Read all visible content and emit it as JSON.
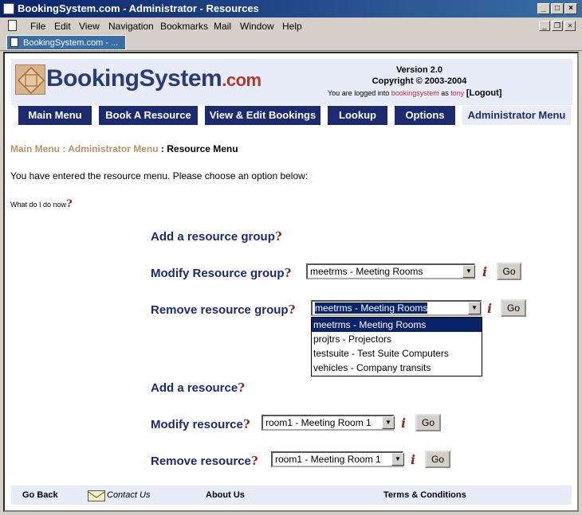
{
  "window": {
    "title": "BookingSystem.com - Administrator - Resources",
    "tab_label": "BookingSystem.com - ..."
  },
  "menubar": [
    "File",
    "Edit",
    "View",
    "Navigation",
    "Bookmarks",
    "Mail",
    "Window",
    "Help"
  ],
  "header": {
    "logo_main": "BookingSystem",
    "logo_suffix": ".com",
    "version": "Version 2.0",
    "copyright": "Copyright © 2003-2004",
    "logged_prefix": "You are logged into ",
    "logged_system": "bookingsystem",
    "logged_as": " as ",
    "logged_user": "tony",
    "logout": "[Logout]"
  },
  "nav": {
    "main_menu": "Main Menu",
    "book_resource": "Book A Resource",
    "view_edit": "View & Edit Bookings",
    "lookup": "Lookup",
    "options": "Options",
    "admin_menu": "Administrator Menu"
  },
  "breadcrumb": {
    "main": "Main Menu",
    "sep": " : ",
    "admin": "Administrator Menu",
    "current": "Resource Menu"
  },
  "intro": "You have entered the resource menu. Please choose an option below:",
  "help_link": "What do I do now",
  "options": {
    "add_group": "Add a resource group",
    "modify_group": "Modify Resource group",
    "modify_group_value": "meetrms - Meeting Rooms",
    "remove_group": "Remove resource group",
    "remove_group_value": "meetrms - Meeting Rooms",
    "add_resource": "Add a resource",
    "modify_resource": "Modify resource",
    "modify_resource_value": "room1 - Meeting Room 1",
    "remove_resource": "Remove resource",
    "remove_resource_value": "room1 - Meeting Room 1",
    "go": "Go",
    "qmark": "?",
    "info": "i"
  },
  "group_dropdown": [
    "meetrms - Meeting Rooms",
    "projtrs - Projectors",
    "testsuite - Test Suite Computers",
    "vehicles - Company transits"
  ],
  "footer": {
    "go_back": "Go Back",
    "contact": "Contact Us",
    "about": "About Us",
    "terms": "Terms & Conditions"
  }
}
